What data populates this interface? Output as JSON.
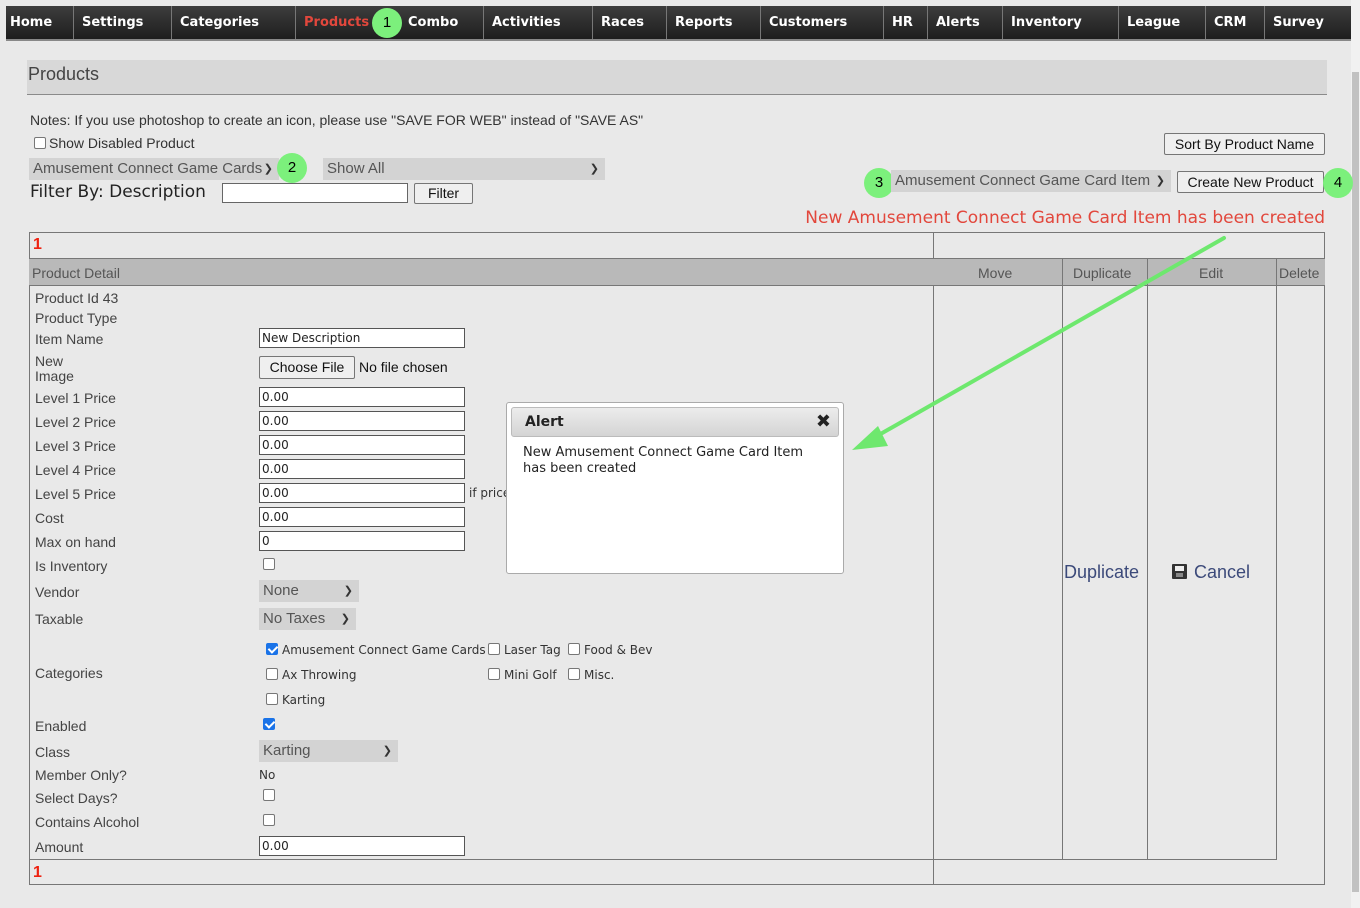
{
  "nav": {
    "items": [
      "Home",
      "Settings",
      "Categories",
      "Products",
      "Combo",
      "Activities",
      "Races",
      "Reports",
      "Customers",
      "HR",
      "Alerts",
      "Inventory",
      "League",
      "CRM",
      "Survey"
    ],
    "active": "Products"
  },
  "page": {
    "title": "Products",
    "notes": "Notes: If you use photoshop to create an icon, please use \"SAVE FOR WEB\" instead of \"SAVE AS\"",
    "show_disabled_label": "Show Disabled Product",
    "show_disabled_checked": false,
    "sort_button": "Sort By Product Name",
    "category_select": "Amusement Connect Game Cards",
    "show_select": "Show All",
    "filter_label": "Filter By: Description",
    "filter_value": "",
    "filter_button": "Filter",
    "type_select": "Amusement Connect Game Card Item",
    "create_button": "Create New Product",
    "status_message": "New Amusement Connect Game Card Item has been created"
  },
  "annotations": {
    "badge1": "1",
    "badge2": "2",
    "badge3": "3",
    "badge4": "4"
  },
  "pagination": {
    "top": "1",
    "bottom": "1"
  },
  "table": {
    "headers": {
      "detail": "Product Detail",
      "move": "Move",
      "duplicate": "Duplicate",
      "edit": "Edit",
      "delete": "Delete"
    },
    "duplicate_link": "Duplicate",
    "cancel_link": "Cancel"
  },
  "product": {
    "labels": {
      "id": "Product Id 43",
      "type": "Product Type",
      "item_name": "Item Name",
      "new": "New",
      "image": "Image",
      "l1": "Level 1 Price",
      "l2": "Level 2 Price",
      "l3": "Level 3 Price",
      "l4": "Level 4 Price",
      "l5": "Level 5 Price",
      "cost": "Cost",
      "max": "Max on hand",
      "is_inventory": "Is Inventory",
      "vendor": "Vendor",
      "taxable": "Taxable",
      "categories": "Categories",
      "enabled": "Enabled",
      "class": "Class",
      "member": "Member Only?",
      "select_days": "Select Days?",
      "alcohol": "Contains Alcohol",
      "amount": "Amount"
    },
    "item_name": "New Description",
    "choose_file": "Choose File",
    "no_file": "No file chosen",
    "l1": "0.00",
    "l2": "0.00",
    "l3": "0.00",
    "l4": "0.00",
    "l5": "0.00",
    "l5_note": "if price",
    "cost": "0.00",
    "max": "0",
    "vendor": "None",
    "taxable": "No Taxes",
    "class": "Karting",
    "member": "No",
    "amount": "0.00",
    "categories": [
      {
        "label": "Amusement Connect Game Cards",
        "checked": true
      },
      {
        "label": "Laser Tag",
        "checked": false
      },
      {
        "label": "Food & Bev",
        "checked": false
      },
      {
        "label": "Ax Throwing",
        "checked": false
      },
      {
        "label": "Mini Golf",
        "checked": false
      },
      {
        "label": "Misc.",
        "checked": false
      },
      {
        "label": "Karting",
        "checked": false
      }
    ],
    "is_inventory": false,
    "enabled": true,
    "select_days": false,
    "alcohol": false
  },
  "alert": {
    "title": "Alert",
    "close": "✖",
    "message": "New Amusement Connect Game Card Item has been created"
  }
}
